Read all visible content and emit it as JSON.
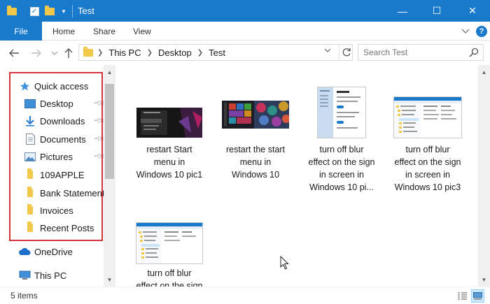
{
  "window": {
    "title": "Test",
    "minimize_glyph": "—",
    "maximize_glyph": "☐",
    "close_glyph": "✕"
  },
  "ribbon": {
    "tabs": [
      {
        "label": "File"
      },
      {
        "label": "Home"
      },
      {
        "label": "Share"
      },
      {
        "label": "View"
      }
    ],
    "expand_icon": "chevron-down-icon",
    "help_icon": "help-icon"
  },
  "address": {
    "crumbs": [
      "This PC",
      "Desktop",
      "Test"
    ],
    "search_placeholder": "Search Test"
  },
  "nav": {
    "quick_access": "Quick access",
    "items": [
      {
        "label": "Desktop",
        "icon": "desktop-icon",
        "pinned": true
      },
      {
        "label": "Downloads",
        "icon": "download-icon",
        "pinned": true
      },
      {
        "label": "Documents",
        "icon": "documents-icon",
        "pinned": true
      },
      {
        "label": "Pictures",
        "icon": "pictures-icon",
        "pinned": true
      },
      {
        "label": "109APPLE",
        "icon": "folder-icon",
        "pinned": false
      },
      {
        "label": "Bank Statement",
        "icon": "folder-icon",
        "pinned": false
      },
      {
        "label": "Invoices",
        "icon": "folder-icon",
        "pinned": false
      },
      {
        "label": "Recent Posts",
        "icon": "folder-icon",
        "pinned": false
      }
    ],
    "onedrive": "OneDrive",
    "this_pc": "This PC"
  },
  "files": [
    {
      "lines": [
        "restart Start",
        "menu in",
        "Windows 10 pic1"
      ],
      "thumb": "dark-start-menu"
    },
    {
      "lines": [
        "restart the start",
        "menu in",
        "Windows 10"
      ],
      "thumb": "start-tiles"
    },
    {
      "lines": [
        "turn off blur",
        "effect on the sign",
        "in screen in",
        "Windows 10 pi..."
      ],
      "thumb": "settings-window"
    },
    {
      "lines": [
        "turn off blur",
        "effect on the sign",
        "in screen in",
        "Windows 10 pic3"
      ],
      "thumb": "regedit-window"
    },
    {
      "lines": [
        "turn off blur",
        "effect on the sign"
      ],
      "thumb": "regedit-window-2"
    }
  ],
  "status": {
    "item_count": "5 items"
  },
  "colors": {
    "accent": "#1979ca",
    "highlight_border": "#d3343d",
    "folder": "#f2c84b"
  }
}
